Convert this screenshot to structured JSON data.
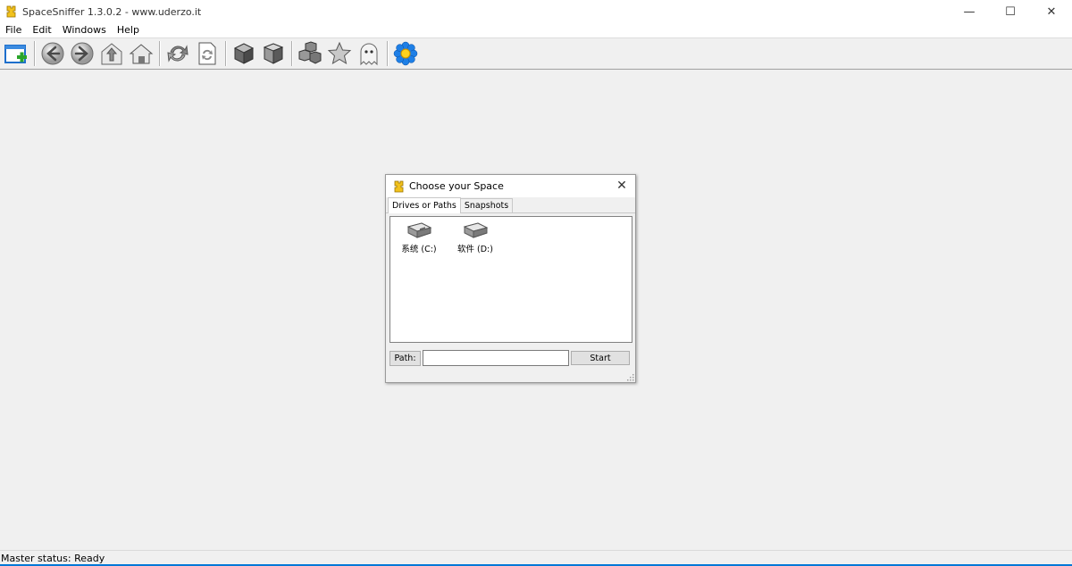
{
  "window": {
    "title": "SpaceSniffer 1.3.0.2 - www.uderzo.it",
    "controls": {
      "minimize": "—",
      "maximize": "☐",
      "close": "✕"
    }
  },
  "menu": [
    "File",
    "Edit",
    "Windows",
    "Help"
  ],
  "toolbar": {
    "buttons": [
      "new-window-icon",
      "back-icon",
      "forward-icon",
      "up-folder-icon",
      "home-icon",
      "refresh-icon",
      "refresh-document-icon",
      "cube-icon",
      "cube-shaded-icon",
      "blocks-icon",
      "star-icon",
      "ghost-icon",
      "settings-flower-icon"
    ]
  },
  "dialog": {
    "title": "Choose your Space",
    "close": "✕",
    "tabs": [
      "Drives or Paths",
      "Snapshots"
    ],
    "drives": [
      {
        "label": "系统 (C:)"
      },
      {
        "label": "软件 (D:)"
      }
    ],
    "path_label": "Path:",
    "path_value": "",
    "start_label": "Start"
  },
  "status": {
    "text": "Master status: Ready"
  },
  "colors": {
    "accent": "#0078d7",
    "flower": "#1e90ff"
  }
}
